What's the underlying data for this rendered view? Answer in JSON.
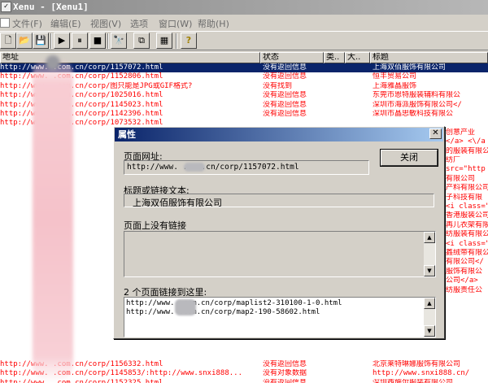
{
  "window": {
    "title": "Xenu - [Xenu1]",
    "icon": "xenu-app-icon"
  },
  "menu": [
    "文件(F)",
    "编辑(E)",
    "视图(V)",
    "选项",
    "窗口(W)",
    "帮助(H)"
  ],
  "toolbar": {
    "buttons": [
      "new-icon",
      "open-icon",
      "save-icon",
      "start-icon",
      "pause-icon",
      "stop-icon",
      "find-icon",
      "copy-icon",
      "properties-icon",
      "help-icon"
    ]
  },
  "list": {
    "columns": [
      "地址",
      "状态",
      "类..",
      "大..",
      "标题"
    ],
    "rows": [
      {
        "url": "http://www.    .com.cn/corp/1157072.html",
        "status": "没有返回信息",
        "title": "上海双佰服饰有限公司",
        "selected": true
      },
      {
        "url": "http://www.    .com.cn/corp/1152806.html",
        "status": "没有返回信息",
        "title": "恒丰贸易公司"
      },
      {
        "url": "http://www.    .com.cn/corp/图只能是JPG或GIF格式?",
        "status": "没有找到",
        "title": "上海雅晶服饰"
      },
      {
        "url": "http://www.    .com.cn/corp/1025016.html",
        "status": "没有返回信息",
        "title": "东莞市恩特服装辅料有限公"
      },
      {
        "url": "http://www.    .com.cn/corp/1145023.html",
        "status": "没有返回信息",
        "title": "深圳市海派服饰有限公司</"
      },
      {
        "url": "http://www.    .com.cn/corp/1142396.html",
        "status": "没有返回信息",
        "title": "深圳市晶思敏科技有限公"
      },
      {
        "url": "http://www.    .com.cn/corp/1073532.html",
        "status": "",
        "title": ""
      },
      {
        "url": "",
        "status": "",
        "title": ""
      },
      {
        "url": "",
        "status": "",
        "title": ""
      },
      {
        "url": "",
        "status": "",
        "title": ""
      },
      {
        "url": "",
        "status": "",
        "title": ""
      },
      {
        "url": "",
        "status": "",
        "title": ""
      },
      {
        "url": "",
        "status": "",
        "title": ""
      },
      {
        "url": "",
        "status": "",
        "title": ""
      },
      {
        "url": "",
        "status": "",
        "title": ""
      },
      {
        "url": "",
        "status": "",
        "title": ""
      },
      {
        "url": "",
        "status": "",
        "title": ""
      },
      {
        "url": "",
        "status": "",
        "title": ""
      },
      {
        "url": "",
        "status": "",
        "title": ""
      },
      {
        "url": "",
        "status": "",
        "title": ""
      },
      {
        "url": "",
        "status": "",
        "title": ""
      },
      {
        "url": "",
        "status": "",
        "title": ""
      },
      {
        "url": "",
        "status": "",
        "title": ""
      },
      {
        "url": "",
        "status": "",
        "title": ""
      },
      {
        "url": "",
        "status": "",
        "title": ""
      },
      {
        "url": "",
        "status": "",
        "title": ""
      },
      {
        "url": "",
        "status": "",
        "title": ""
      },
      {
        "url": "",
        "status": "",
        "title": ""
      },
      {
        "url": "",
        "status": "",
        "title": ""
      },
      {
        "url": "",
        "status": "",
        "title": ""
      },
      {
        "url": "",
        "status": "",
        "title": ""
      },
      {
        "url": "",
        "status": "",
        "title": ""
      },
      {
        "url": "http://www.    .com.cn/corp/1156332.html",
        "status": "没有返回信息",
        "title": "北京莱特琳娜服饰有限公司"
      },
      {
        "url": "http://www.    .com.cn/corp/1145853/:http://www.snxi888...",
        "status": "没有对象数据",
        "title": "http://www.snxi888.cn/"
      },
      {
        "url": "http://www.    .com.cn/corp/1152325.html",
        "status": "没有返回信息",
        "title": "深圳西施尔服装有限公司"
      }
    ],
    "right_fragments": [
      "创意产业",
      "</a> <\\/a",
      "的服装有限公",
      "纺厂",
      "src=\"http",
      "有限公司",
      "产料有限公司",
      "子科技有限",
      "<i class=\"",
      "香港服装公司",
      "再儿衣架有限",
      "纺服装有限公",
      "<i class=\"",
      "鑫绒带有限公",
      "有限公司</",
      "服饰有限公",
      "公司</a>",
      "纺服责任公"
    ]
  },
  "dialog": {
    "title": "属性",
    "url_label": "页面网址:",
    "url_value": "http://www.    .com.cn/corp/1157072.html",
    "close_button": "关闭",
    "text_label": "标题或链接文本:",
    "text_value": "上海双佰服饰有限公司",
    "no_links_label": "页面上没有链接",
    "incoming_label": "2 个页面链接到这里:",
    "incoming_links": [
      "http://www.    .com.cn/corp/maplist2-310100-1-0.html",
      "http://www.    .com.cn/corp/map2-190-58602.html"
    ]
  }
}
